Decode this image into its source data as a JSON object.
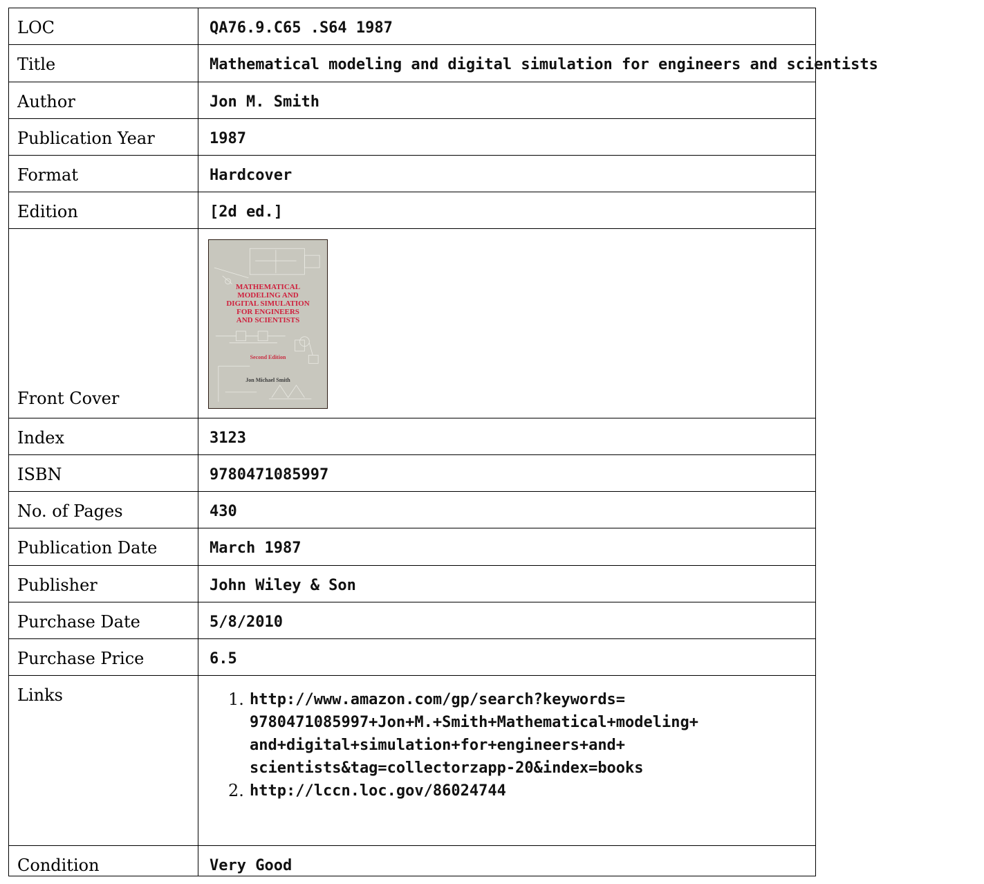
{
  "record": {
    "loc": {
      "label": "LOC",
      "value": "QA76.9.C65 .S64 1987"
    },
    "title": {
      "label": "Title",
      "value": "Mathematical modeling and digital simulation for engineers and scientists"
    },
    "author": {
      "label": "Author",
      "value": "Jon M. Smith"
    },
    "publication_year": {
      "label": "Publication Year",
      "value": "1987"
    },
    "format": {
      "label": "Format",
      "value": "Hardcover"
    },
    "edition": {
      "label": "Edition",
      "value": "[2d ed.]"
    },
    "front_cover": {
      "label": "Front Cover",
      "cover_title_lines": [
        "MATHEMATICAL",
        "MODELING AND",
        "DIGITAL SIMULATION",
        "FOR ENGINEERS",
        "AND SCIENTISTS"
      ],
      "cover_edition": "Second Edition",
      "cover_author": "Jon Michael Smith",
      "cover_colors": {
        "background": "#c8c7be",
        "title": "#cf1f3c"
      }
    },
    "index": {
      "label": "Index",
      "value": "3123"
    },
    "isbn": {
      "label": "ISBN",
      "value": "9780471085997"
    },
    "pages": {
      "label": "No. of Pages",
      "value": "430"
    },
    "publication_date": {
      "label": "Publication Date",
      "value": "March 1987"
    },
    "publisher": {
      "label": "Publisher",
      "value": "John Wiley & Son"
    },
    "purchase_date": {
      "label": "Purchase Date",
      "value": "5/8/2010"
    },
    "purchase_price": {
      "label": "Purchase Price",
      "value": "6.5"
    },
    "links": {
      "label": "Links",
      "items": [
        {
          "number": "1.",
          "url": "http://www.amazon.com/gp/search?keywords=9780471085997+Jon+M.+Smith+Mathematical+modeling+and+digital+simulation+for+engineers+and+scientists&tag=collectorzapp-20&index=books",
          "display_lines": [
            "http://www.amazon.com/gp/search?keywords=",
            "9780471085997+Jon+M.+Smith+Mathematical+modeling+",
            "and+digital+simulation+for+engineers+and+",
            "scientists&tag=collectorzapp-20&index=books"
          ]
        },
        {
          "number": "2.",
          "url": "http://lccn.loc.gov/86024744",
          "display_lines": [
            "http://lccn.loc.gov/86024744"
          ]
        }
      ]
    },
    "condition": {
      "label": "Condition",
      "value": "Very Good"
    }
  }
}
